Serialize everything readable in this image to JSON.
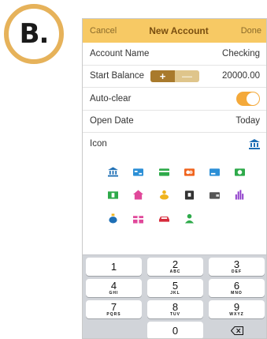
{
  "badge": {
    "label": "B."
  },
  "navbar": {
    "cancel": "Cancel",
    "title": "New Account",
    "done": "Done"
  },
  "form": {
    "account_name": {
      "label": "Account Name",
      "value": "Checking"
    },
    "start_balance": {
      "label": "Start Balance",
      "plus": "+",
      "minus": "—",
      "value": "20000.00"
    },
    "auto_clear": {
      "label": "Auto-clear",
      "on": true
    },
    "open_date": {
      "label": "Open Date",
      "value": "Today"
    },
    "icon": {
      "label": "Icon",
      "selected": "bank-icon"
    }
  },
  "icons": [
    {
      "name": "bank-icon",
      "color": "#1e6fb5"
    },
    {
      "name": "card-icon",
      "color": "#2b8fd6"
    },
    {
      "name": "card-green-icon",
      "color": "#2eaa4a"
    },
    {
      "name": "credit-card-orange-icon",
      "color": "#f0641e"
    },
    {
      "name": "card-blue-icon",
      "color": "#2b8fd6"
    },
    {
      "name": "cash-icon",
      "color": "#2eaa4a"
    },
    {
      "name": "banknotes-icon",
      "color": "#2eaa4a"
    },
    {
      "name": "house-icon",
      "color": "#e0489a"
    },
    {
      "name": "piggy-bank-icon",
      "color": "#f0b41e"
    },
    {
      "name": "safe-icon",
      "color": "#333333"
    },
    {
      "name": "wallet-icon",
      "color": "#555555"
    },
    {
      "name": "bar-chart-icon",
      "color": "#8a35c8"
    },
    {
      "name": "money-bag-icon",
      "color": "#1e6fb5"
    },
    {
      "name": "gift-icon",
      "color": "#e0489a"
    },
    {
      "name": "car-icon",
      "color": "#d62a3a"
    },
    {
      "name": "person-icon",
      "color": "#2eaa4a"
    }
  ],
  "keypad": {
    "keys": [
      {
        "digit": "1",
        "letters": ""
      },
      {
        "digit": "2",
        "letters": "ABC"
      },
      {
        "digit": "3",
        "letters": "DEF"
      },
      {
        "digit": "4",
        "letters": "GHI"
      },
      {
        "digit": "5",
        "letters": "JKL"
      },
      {
        "digit": "6",
        "letters": "MNO"
      },
      {
        "digit": "7",
        "letters": "PQRS"
      },
      {
        "digit": "8",
        "letters": "TUV"
      },
      {
        "digit": "9",
        "letters": "WXYZ"
      },
      {
        "digit": "0",
        "letters": ""
      }
    ],
    "backspace_icon": "backspace-icon"
  },
  "colors": {
    "accent": "#f7c964",
    "toggle": "#f4a93a",
    "plus": "#a97a2c",
    "minus": "#dfc58b"
  }
}
